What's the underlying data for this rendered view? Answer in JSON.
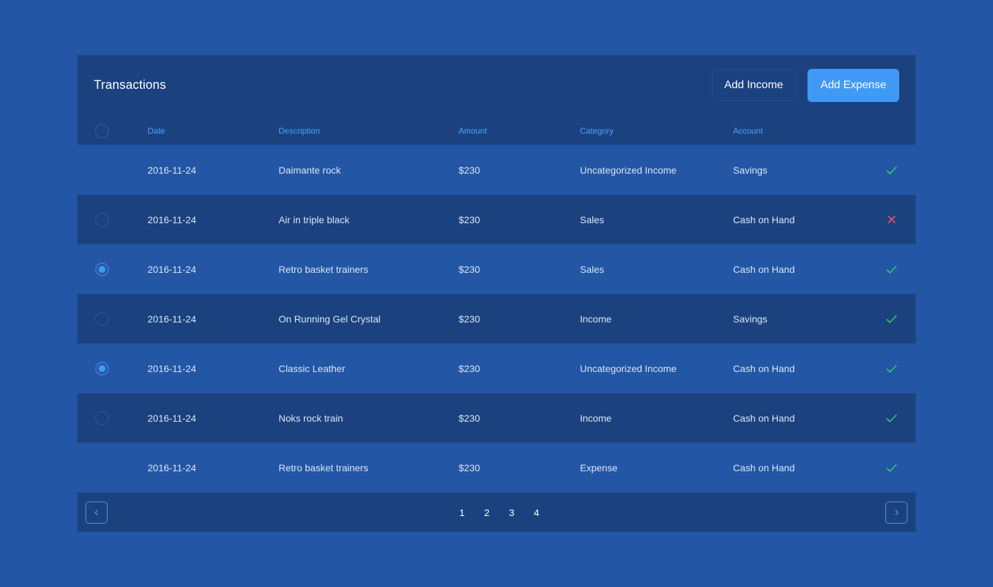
{
  "header": {
    "title": "Transactions",
    "add_income_label": "Add Income",
    "add_expense_label": "Add Expense"
  },
  "columns": {
    "date": "Date",
    "description": "Description",
    "amount": "Amount",
    "category": "Category",
    "account": "Account"
  },
  "rows": [
    {
      "date": "2016-11-24",
      "description": "Daimante rock",
      "amount": "$230",
      "category": "Uncategorized Income",
      "account": "Savings",
      "status": "check-icon",
      "selected": false
    },
    {
      "date": "2016-11-24",
      "description": "Air in triple black",
      "amount": "$230",
      "category": "Sales",
      "account": "Cash on Hand",
      "status": "cross-icon",
      "selected": false
    },
    {
      "date": "2016-11-24",
      "description": "Retro basket trainers",
      "amount": "$230",
      "category": "Sales",
      "account": "Cash on Hand",
      "status": "check-icon",
      "selected": true
    },
    {
      "date": "2016-11-24",
      "description": "On Running Gel Crystal",
      "amount": "$230",
      "category": "Income",
      "account": "Savings",
      "status": "check-icon",
      "selected": false
    },
    {
      "date": "2016-11-24",
      "description": "Classic Leather",
      "amount": "$230",
      "category": "Uncategorized Income",
      "account": "Cash on Hand",
      "status": "check-icon",
      "selected": true
    },
    {
      "date": "2016-11-24",
      "description": "Noks rock train",
      "amount": "$230",
      "category": "Income",
      "account": "Cash on Hand",
      "status": "check-icon",
      "selected": false
    },
    {
      "date": "2016-11-24",
      "description": "Retro basket trainers",
      "amount": "$230",
      "category": "Expense",
      "account": "Cash on Hand",
      "status": "check-icon",
      "selected": false
    }
  ],
  "pagination": {
    "pages": [
      "1",
      "2",
      "3",
      "4"
    ],
    "prev_icon": "chevron-left-icon",
    "next_icon": "chevron-right-icon"
  },
  "colors": {
    "background": "#2356a5",
    "panel": "#1b427f",
    "accent": "#4199f6",
    "success": "#2fcf6a",
    "danger": "#f0506e"
  }
}
